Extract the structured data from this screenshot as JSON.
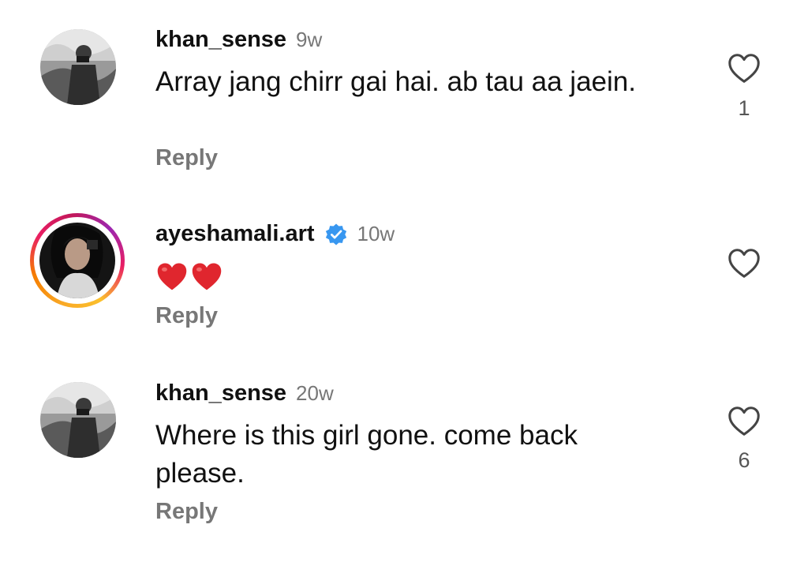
{
  "comments": [
    {
      "username": "khan_sense",
      "time": "9w",
      "text": "Array jang chirr gai hai. ab tau aa jaein.",
      "reply_label": "Reply",
      "like_count": "1",
      "verified": false,
      "avatar": "grayscale-photo"
    },
    {
      "username": "ayeshamali.art",
      "time": "10w",
      "text": "",
      "emojis": [
        "red-heart",
        "red-heart"
      ],
      "reply_label": "Reply",
      "like_count": "",
      "verified": true,
      "has_story_ring": true,
      "avatar": "dark-photo"
    },
    {
      "username": "khan_sense",
      "time": "20w",
      "text": "Where is this girl gone. come back please.",
      "reply_label": "Reply",
      "like_count": "6",
      "verified": false,
      "avatar": "grayscale-photo"
    }
  ],
  "colors": {
    "username": "#111111",
    "meta": "#777777",
    "verified_blue": "#3897f0",
    "heart_red": "#e0262e"
  }
}
